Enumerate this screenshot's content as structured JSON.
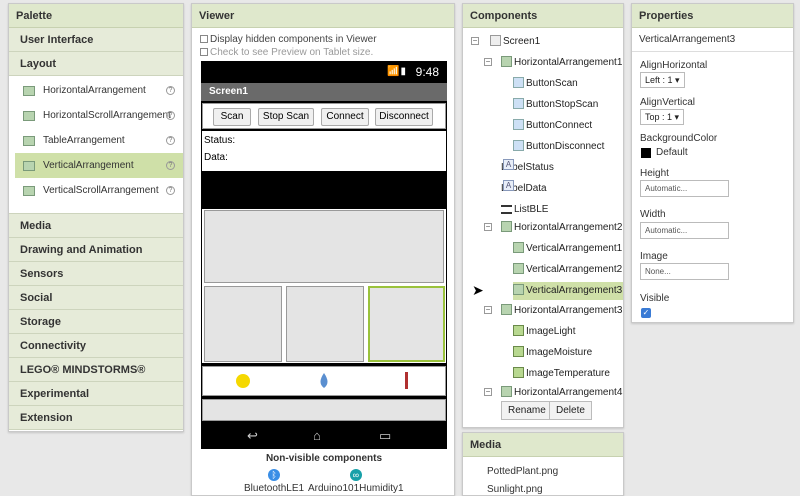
{
  "palette": {
    "title": "Palette",
    "categories_top": [
      "User Interface",
      "Layout"
    ],
    "layout_items": [
      {
        "label": "HorizontalArrangement",
        "help": "?"
      },
      {
        "label": "HorizontalScrollArrangement",
        "help": "?"
      },
      {
        "label": "TableArrangement",
        "help": "?"
      },
      {
        "label": "VerticalArrangement",
        "help": "?"
      },
      {
        "label": "VerticalScrollArrangement",
        "help": "?"
      }
    ],
    "categories_bottom": [
      "Media",
      "Drawing and Animation",
      "Sensors",
      "Social",
      "Storage",
      "Connectivity",
      "LEGO® MINDSTORMS®",
      "Experimental",
      "Extension"
    ]
  },
  "viewer": {
    "title": "Viewer",
    "option_hidden": "Display hidden components in Viewer",
    "option_tablet": "Check to see Preview on Tablet size.",
    "time": "9:48",
    "screen_title": "Screen1",
    "buttons": [
      "Scan",
      "Stop Scan",
      "Connect",
      "Disconnect"
    ],
    "status_label": "Status:",
    "data_label": "Data:",
    "nonvisible_title": "Non-visible components",
    "nonvisible": [
      "BluetoothLE1",
      "Arduino101Humidity1"
    ]
  },
  "components": {
    "title": "Components",
    "tree": {
      "screen": "Screen1",
      "ha1": "HorizontalArrangement1",
      "btn_scan": "ButtonScan",
      "btn_stop": "ButtonStopScan",
      "btn_connect": "ButtonConnect",
      "btn_disconnect": "ButtonDisconnect",
      "label_status": "LabelStatus",
      "label_data": "LabelData",
      "list_ble": "ListBLE",
      "ha2": "HorizontalArrangement2",
      "va1": "VerticalArrangement1",
      "va2": "VerticalArrangement2",
      "va3": "VerticalArrangement3",
      "ha3": "HorizontalArrangement3",
      "img_light": "ImageLight",
      "img_moisture": "ImageMoisture",
      "img_temp": "ImageTemperature",
      "ha4": "HorizontalArrangement4"
    },
    "rename": "Rename",
    "delete": "Delete"
  },
  "media": {
    "title": "Media",
    "items": [
      "PottedPlant.png",
      "Sunlight.png"
    ]
  },
  "properties": {
    "title": "Properties",
    "component": "VerticalArrangement3",
    "align_h_label": "AlignHorizontal",
    "align_h_value": "Left : 1 ▾",
    "align_v_label": "AlignVertical",
    "align_v_value": "Top : 1 ▾",
    "bg_label": "BackgroundColor",
    "bg_value": "Default",
    "height_label": "Height",
    "height_value": "Automatic...",
    "width_label": "Width",
    "width_value": "Automatic...",
    "image_label": "Image",
    "image_value": "None...",
    "visible_label": "Visible",
    "visible_checked": true
  }
}
